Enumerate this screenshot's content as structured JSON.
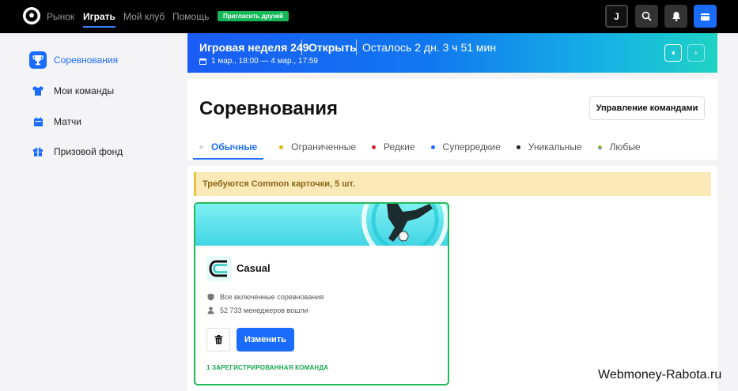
{
  "topbar": {
    "logo_icon": "soccer-ball-icon",
    "nav": [
      {
        "label": "Рынок",
        "active": false
      },
      {
        "label": "Играть",
        "active": true
      },
      {
        "label": "Мой клуб",
        "active": false
      },
      {
        "label": "Помощь",
        "active": false
      }
    ],
    "invite_label": "Пригласить друзей",
    "avatar_letter": "J",
    "icons": [
      "search-icon",
      "bell-icon",
      "wallet-icon"
    ]
  },
  "sidebar": {
    "items": [
      {
        "label": "Соревнования",
        "icon": "trophy-icon",
        "active": true
      },
      {
        "label": "Мои команды",
        "icon": "shirt-icon",
        "active": false
      },
      {
        "label": "Матчи",
        "icon": "calendar-icon",
        "active": false
      },
      {
        "label": "Призовой фонд",
        "icon": "gift-icon",
        "active": false
      }
    ]
  },
  "week_banner": {
    "title": "Игровая неделя 249",
    "status": "Открыть",
    "time_left": "Осталось 2 дн. 3 ч 51 мин",
    "dates": "1 мар., 18:00 — 4 мар., 17:59"
  },
  "main": {
    "title": "Соревнования",
    "manage_button": "Управление командами",
    "tabs": [
      {
        "label": "Обычные",
        "color": "#d9d9d9",
        "active": true
      },
      {
        "label": "Ограниченные",
        "color": "#e8b600",
        "active": false
      },
      {
        "label": "Редкие",
        "color": "#d4222a",
        "active": false
      },
      {
        "label": "Суперредкие",
        "color": "#1a6cff",
        "active": false
      },
      {
        "label": "Уникальные",
        "color": "#222222",
        "active": false
      },
      {
        "label": "Любые",
        "color": "#7bbf3a",
        "active": false
      }
    ],
    "warning": "Требуются Common карточки, 5 шт."
  },
  "card": {
    "name": "Casual",
    "meta_competitions": "Все включенные соревнования",
    "meta_managers": "52 733 менеджеров вошли",
    "edit_button": "Изменить",
    "registered": "1 ЗАРЕГИСТРИРОВАННАЯ КОМАНДА"
  },
  "watermark": "Webmoney-Rabota.ru",
  "colors": {
    "accent": "#1a6cff",
    "success": "#1fba5a",
    "warning_bg": "#fbe9b7"
  }
}
